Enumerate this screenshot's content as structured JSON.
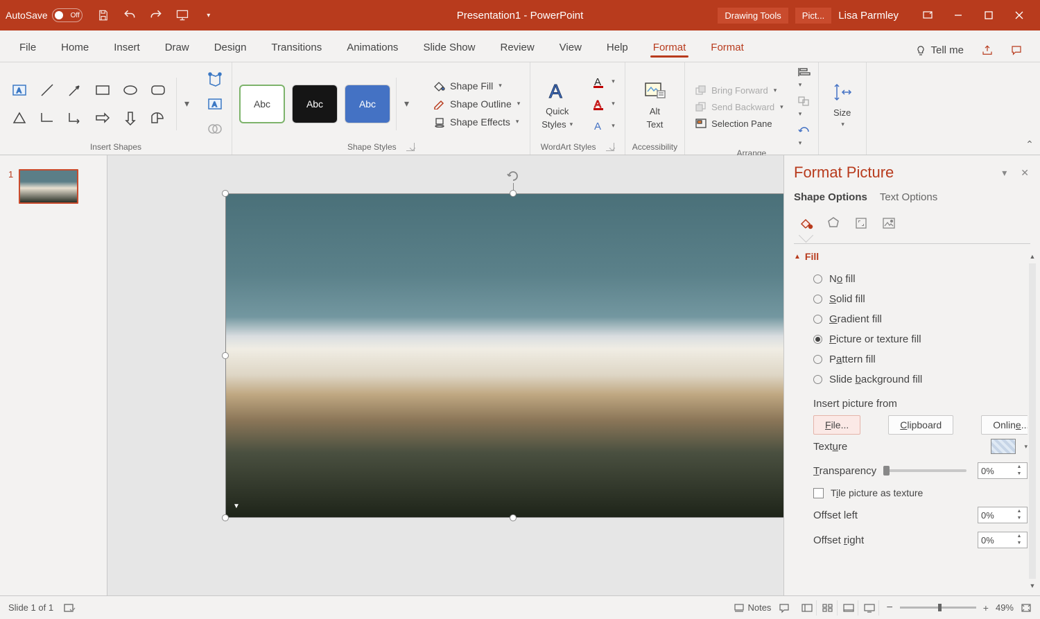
{
  "titlebar": {
    "autosave_label": "AutoSave",
    "autosave_state": "Off",
    "title": "Presentation1  -  PowerPoint",
    "context1": "Drawing Tools",
    "context2": "Pict...",
    "user": "Lisa Parmley"
  },
  "tabs": {
    "file": "File",
    "home": "Home",
    "insert": "Insert",
    "draw": "Draw",
    "design": "Design",
    "transitions": "Transitions",
    "animations": "Animations",
    "slideshow": "Slide Show",
    "review": "Review",
    "view": "View",
    "help": "Help",
    "format1": "Format",
    "format2": "Format",
    "tellme": "Tell me"
  },
  "ribbon": {
    "insert_shapes": "Insert Shapes",
    "shape_styles": "Shape Styles",
    "shape_fill": "Shape Fill",
    "shape_outline": "Shape Outline",
    "shape_effects": "Shape Effects",
    "abc": "Abc",
    "quick_styles": "Quick",
    "quick_styles2": "Styles",
    "wordart_styles": "WordArt Styles",
    "alt_text": "Alt",
    "alt_text2": "Text",
    "accessibility": "Accessibility",
    "bring_forward": "Bring Forward",
    "send_backward": "Send Backward",
    "selection_pane": "Selection Pane",
    "arrange": "Arrange",
    "size_lbl": "Size"
  },
  "thumb": {
    "num": "1"
  },
  "pane": {
    "title": "Format Picture",
    "tab_shape": "Shape Options",
    "tab_text": "Text Options",
    "section_fill": "Fill",
    "no_fill_pre": "N",
    "no_fill_u": "o",
    "no_fill_post": " fill",
    "solid_u": "S",
    "solid_post": "olid fill",
    "grad_u": "G",
    "grad_post": "radient fill",
    "pic_u": "P",
    "pic_post": "icture or texture fill",
    "patt_pre": "P",
    "patt_u": "a",
    "patt_post": "ttern fill",
    "bg_pre": "Slide ",
    "bg_u": "b",
    "bg_post": "ackground fill",
    "insert_from": "Insert picture from",
    "btn_file_u": "F",
    "btn_file_post": "ile...",
    "btn_clip_u": "C",
    "btn_clip_post": "lipboard",
    "btn_online_pre": "Onlin",
    "btn_online_u": "e",
    "btn_online_post": "...",
    "texture_pre": "Text",
    "texture_u": "u",
    "texture_post": "re",
    "transp_u": "T",
    "transp_post": "ransparency",
    "tile_pre": "T",
    "tile_u": "i",
    "tile_post": "le picture as texture",
    "offset_left": "Offset left",
    "offset_right_pre": "Offset ",
    "offset_right_u": "r",
    "offset_right_post": "ight",
    "pct0": "0%"
  },
  "status": {
    "slide": "Slide 1 of 1",
    "notes": "Notes",
    "zoom": "49%"
  }
}
